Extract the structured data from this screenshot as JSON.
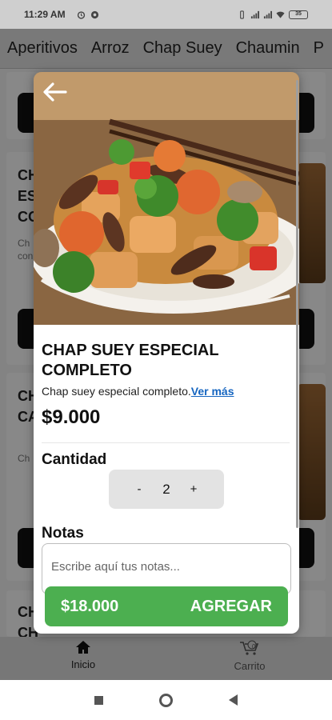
{
  "status_bar": {
    "time": "11:29 AM",
    "battery": "35"
  },
  "categories": [
    "Aperitivos",
    "Arroz",
    "Chap Suey",
    "Chaumin",
    "P"
  ],
  "background_list": {
    "cards": [
      {
        "title": "",
        "desc": ""
      },
      {
        "title": "CH\nES\nCO",
        "desc": "Ch\ncon"
      },
      {
        "title": "CH\nCA",
        "desc": "Ch"
      },
      {
        "title": "CH\nCH",
        "desc": ""
      }
    ]
  },
  "modal": {
    "title": "CHAP SUEY ESPECIAL COMPLETO",
    "description": "Chap suey especial completo.",
    "see_more": "Ver más",
    "price": "$9.000",
    "quantity_label": "Cantidad",
    "quantity": "2",
    "minus": "-",
    "plus": "+",
    "notes_label": "Notas",
    "notes_placeholder": "Escribe aquí tus notas...",
    "total": "$18.000",
    "add_label": "AGREGAR"
  },
  "bottom_nav": {
    "home": "Inicio",
    "cart": "Carrito",
    "cart_count": "0"
  },
  "colors": {
    "accent_green": "#4caf50",
    "link_blue": "#1565c0"
  }
}
